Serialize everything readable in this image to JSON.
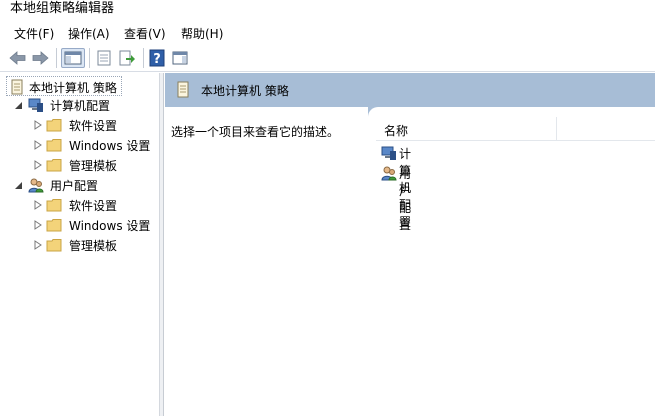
{
  "window": {
    "title": "本地组策略编辑器"
  },
  "menu": [
    {
      "label": "文件(F)"
    },
    {
      "label": "操作(A)"
    },
    {
      "label": "查看(V)"
    },
    {
      "label": "帮助(H)"
    }
  ],
  "toolbar": {
    "buttons": [
      "back-arrow-icon",
      "forward-arrow-icon",
      "show-hide-console-tree-icon",
      "properties-icon",
      "export-list-icon",
      "help-icon",
      "show-hide-action-pane-icon"
    ]
  },
  "tree": {
    "root": "本地计算机 策略",
    "computer": {
      "label": "计算机配置",
      "children": [
        "软件设置",
        "Windows 设置",
        "管理模板"
      ]
    },
    "user": {
      "label": "用户配置",
      "children": [
        "软件设置",
        "Windows 设置",
        "管理模板"
      ]
    }
  },
  "right": {
    "header": "本地计算机 策略",
    "description": "选择一个项目来查看它的描述。",
    "column": "名称",
    "items": [
      "计算机配置",
      "用户配置"
    ]
  },
  "colors": {
    "header_bg": "#a7bdd6",
    "folder": "#f3d37a"
  }
}
